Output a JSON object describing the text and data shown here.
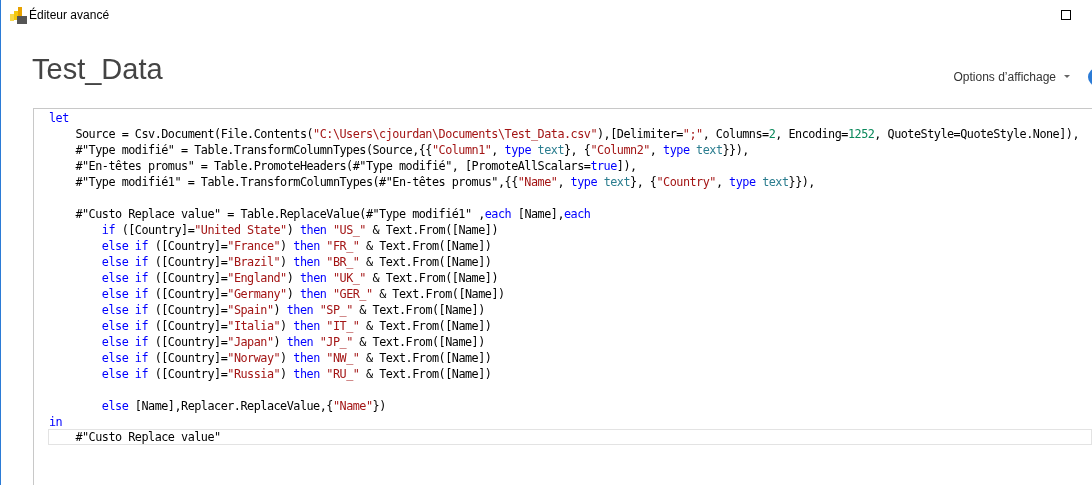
{
  "window": {
    "title": "Éditeur avancé"
  },
  "heading": "Test_Data",
  "view_options": {
    "label": "Options d’affichage"
  },
  "editor": {
    "lines": [
      {
        "kind": "code",
        "current": false,
        "tokens": [
          {
            "kind": "keyword",
            "text": "let"
          }
        ]
      },
      {
        "kind": "code",
        "current": false,
        "tokens": [
          {
            "kind": "plain",
            "text": "    Source = Csv.Document(File.Contents("
          },
          {
            "kind": "string",
            "text": "\"C:\\Users\\cjourdan\\Documents\\Test_Data.csv\""
          },
          {
            "kind": "plain",
            "text": "),[Delimiter="
          },
          {
            "kind": "string",
            "text": "\";\""
          },
          {
            "kind": "plain",
            "text": ", Columns="
          },
          {
            "kind": "number",
            "text": "2"
          },
          {
            "kind": "plain",
            "text": ", Encoding="
          },
          {
            "kind": "number",
            "text": "1252"
          },
          {
            "kind": "plain",
            "text": ", QuoteStyle=QuoteStyle.None]),"
          }
        ]
      },
      {
        "kind": "code",
        "current": false,
        "tokens": [
          {
            "kind": "plain",
            "text": "    #\"Type modifié\" = Table.TransformColumnTypes(Source,{{"
          },
          {
            "kind": "string",
            "text": "\"Column1\""
          },
          {
            "kind": "plain",
            "text": ", "
          },
          {
            "kind": "keyword",
            "text": "type"
          },
          {
            "kind": "type",
            "text": " text"
          },
          {
            "kind": "plain",
            "text": "}, {"
          },
          {
            "kind": "string",
            "text": "\"Column2\""
          },
          {
            "kind": "plain",
            "text": ", "
          },
          {
            "kind": "keyword",
            "text": "type"
          },
          {
            "kind": "type",
            "text": " text"
          },
          {
            "kind": "plain",
            "text": "}}),"
          }
        ]
      },
      {
        "kind": "code",
        "current": false,
        "tokens": [
          {
            "kind": "plain",
            "text": "    #\"En-têtes promus\" = Table.PromoteHeaders(#\"Type modifié\", [PromoteAllScalars="
          },
          {
            "kind": "keyword",
            "text": "true"
          },
          {
            "kind": "plain",
            "text": "]),"
          }
        ]
      },
      {
        "kind": "code",
        "current": false,
        "tokens": [
          {
            "kind": "plain",
            "text": "    #\"Type modifié1\" = Table.TransformColumnTypes(#\"En-têtes promus\",{{"
          },
          {
            "kind": "string",
            "text": "\"Name\""
          },
          {
            "kind": "plain",
            "text": ", "
          },
          {
            "kind": "keyword",
            "text": "type"
          },
          {
            "kind": "type",
            "text": " text"
          },
          {
            "kind": "plain",
            "text": "}, {"
          },
          {
            "kind": "string",
            "text": "\"Country\""
          },
          {
            "kind": "plain",
            "text": ", "
          },
          {
            "kind": "keyword",
            "text": "type"
          },
          {
            "kind": "type",
            "text": " text"
          },
          {
            "kind": "plain",
            "text": "}}),"
          }
        ]
      },
      {
        "kind": "blank",
        "current": false
      },
      {
        "kind": "code",
        "current": false,
        "tokens": [
          {
            "kind": "plain",
            "text": "    #\"Custo Replace value\" = Table.ReplaceValue(#\"Type modifié1\" ,"
          },
          {
            "kind": "keyword",
            "text": "each"
          },
          {
            "kind": "plain",
            "text": " [Name],"
          },
          {
            "kind": "keyword",
            "text": "each"
          }
        ]
      },
      {
        "kind": "code",
        "current": false,
        "tokens": [
          {
            "kind": "keyword",
            "text": "        if"
          },
          {
            "kind": "plain",
            "text": " ([Country]="
          },
          {
            "kind": "string",
            "text": "\"United State\""
          },
          {
            "kind": "plain",
            "text": ") "
          },
          {
            "kind": "keyword",
            "text": "then"
          },
          {
            "kind": "string",
            "text": " \"US_\""
          },
          {
            "kind": "plain",
            "text": " & Text.From([Name])"
          }
        ]
      },
      {
        "kind": "code",
        "current": false,
        "tokens": [
          {
            "kind": "keyword",
            "text": "        else if"
          },
          {
            "kind": "plain",
            "text": " ([Country]="
          },
          {
            "kind": "string",
            "text": "\"France\""
          },
          {
            "kind": "plain",
            "text": ") "
          },
          {
            "kind": "keyword",
            "text": "then"
          },
          {
            "kind": "string",
            "text": " \"FR_\""
          },
          {
            "kind": "plain",
            "text": " & Text.From([Name])"
          }
        ]
      },
      {
        "kind": "code",
        "current": false,
        "tokens": [
          {
            "kind": "keyword",
            "text": "        else if"
          },
          {
            "kind": "plain",
            "text": " ([Country]="
          },
          {
            "kind": "string",
            "text": "\"Brazil\""
          },
          {
            "kind": "plain",
            "text": ") "
          },
          {
            "kind": "keyword",
            "text": "then"
          },
          {
            "kind": "string",
            "text": " \"BR_\""
          },
          {
            "kind": "plain",
            "text": " & Text.From([Name])"
          }
        ]
      },
      {
        "kind": "code",
        "current": false,
        "tokens": [
          {
            "kind": "keyword",
            "text": "        else if"
          },
          {
            "kind": "plain",
            "text": " ([Country]="
          },
          {
            "kind": "string",
            "text": "\"England\""
          },
          {
            "kind": "plain",
            "text": ") "
          },
          {
            "kind": "keyword",
            "text": "then"
          },
          {
            "kind": "string",
            "text": " \"UK_\""
          },
          {
            "kind": "plain",
            "text": " & Text.From([Name])"
          }
        ]
      },
      {
        "kind": "code",
        "current": false,
        "tokens": [
          {
            "kind": "keyword",
            "text": "        else if"
          },
          {
            "kind": "plain",
            "text": " ([Country]="
          },
          {
            "kind": "string",
            "text": "\"Germany\""
          },
          {
            "kind": "plain",
            "text": ") "
          },
          {
            "kind": "keyword",
            "text": "then"
          },
          {
            "kind": "string",
            "text": " \"GER_\""
          },
          {
            "kind": "plain",
            "text": " & Text.From([Name])"
          }
        ]
      },
      {
        "kind": "code",
        "current": false,
        "tokens": [
          {
            "kind": "keyword",
            "text": "        else if"
          },
          {
            "kind": "plain",
            "text": " ([Country]="
          },
          {
            "kind": "string",
            "text": "\"Spain\""
          },
          {
            "kind": "plain",
            "text": ") "
          },
          {
            "kind": "keyword",
            "text": "then"
          },
          {
            "kind": "string",
            "text": " \"SP_\""
          },
          {
            "kind": "plain",
            "text": " & Text.From([Name])"
          }
        ]
      },
      {
        "kind": "code",
        "current": false,
        "tokens": [
          {
            "kind": "keyword",
            "text": "        else if"
          },
          {
            "kind": "plain",
            "text": " ([Country]="
          },
          {
            "kind": "string",
            "text": "\"Italia\""
          },
          {
            "kind": "plain",
            "text": ") "
          },
          {
            "kind": "keyword",
            "text": "then"
          },
          {
            "kind": "string",
            "text": " \"IT_\""
          },
          {
            "kind": "plain",
            "text": " & Text.From([Name])"
          }
        ]
      },
      {
        "kind": "code",
        "current": false,
        "tokens": [
          {
            "kind": "keyword",
            "text": "        else if"
          },
          {
            "kind": "plain",
            "text": " ([Country]="
          },
          {
            "kind": "string",
            "text": "\"Japan\""
          },
          {
            "kind": "plain",
            "text": ") "
          },
          {
            "kind": "keyword",
            "text": "then"
          },
          {
            "kind": "string",
            "text": " \"JP_\""
          },
          {
            "kind": "plain",
            "text": " & Text.From([Name])"
          }
        ]
      },
      {
        "kind": "code",
        "current": false,
        "tokens": [
          {
            "kind": "keyword",
            "text": "        else if"
          },
          {
            "kind": "plain",
            "text": " ([Country]="
          },
          {
            "kind": "string",
            "text": "\"Norway\""
          },
          {
            "kind": "plain",
            "text": ") "
          },
          {
            "kind": "keyword",
            "text": "then"
          },
          {
            "kind": "string",
            "text": " \"NW_\""
          },
          {
            "kind": "plain",
            "text": " & Text.From([Name])"
          }
        ]
      },
      {
        "kind": "code",
        "current": false,
        "tokens": [
          {
            "kind": "keyword",
            "text": "        else if"
          },
          {
            "kind": "plain",
            "text": " ([Country]="
          },
          {
            "kind": "string",
            "text": "\"Russia\""
          },
          {
            "kind": "plain",
            "text": ") "
          },
          {
            "kind": "keyword",
            "text": "then"
          },
          {
            "kind": "string",
            "text": " \"RU_\""
          },
          {
            "kind": "plain",
            "text": " & Text.From([Name])"
          }
        ]
      },
      {
        "kind": "blank",
        "current": false
      },
      {
        "kind": "code",
        "current": false,
        "tokens": [
          {
            "kind": "keyword",
            "text": "        else"
          },
          {
            "kind": "plain",
            "text": " [Name],Replacer.ReplaceValue,{"
          },
          {
            "kind": "string",
            "text": "\"Name\""
          },
          {
            "kind": "plain",
            "text": "})"
          }
        ]
      },
      {
        "kind": "code",
        "current": false,
        "tokens": [
          {
            "kind": "keyword",
            "text": "in"
          }
        ]
      },
      {
        "kind": "code",
        "current": true,
        "tokens": [
          {
            "kind": "plain",
            "text": "    #\"Custo Replace value\""
          }
        ]
      }
    ]
  }
}
